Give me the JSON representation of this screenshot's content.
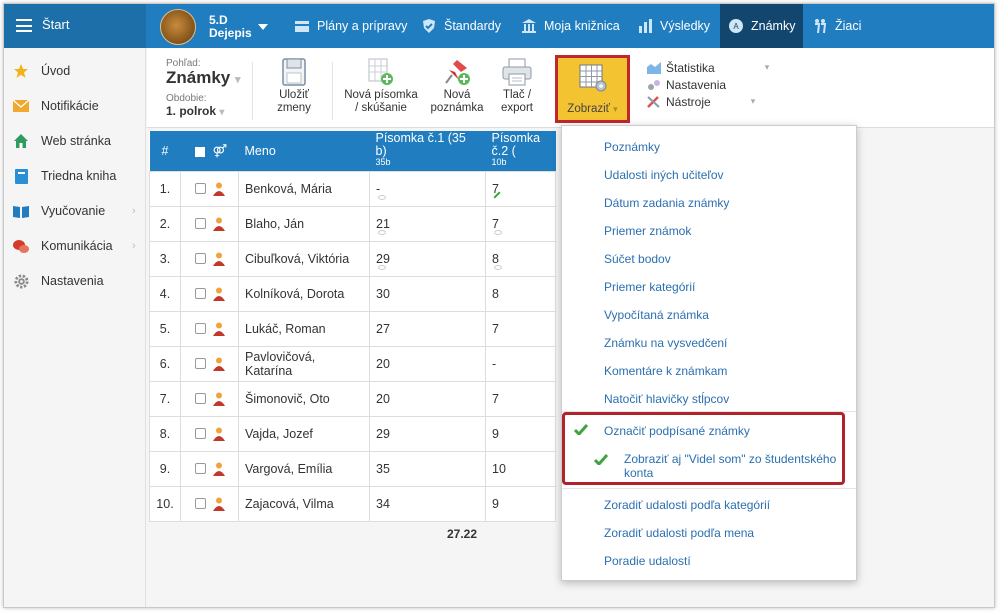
{
  "topbar": {
    "start": "Štart",
    "class_code": "5.D",
    "class_subject": "Dejepis",
    "nav": [
      {
        "label": "Plány a prípravy",
        "icon": "folder-icon"
      },
      {
        "label": "Štandardy",
        "icon": "shield-icon"
      },
      {
        "label": "Moja knižnica",
        "icon": "library-icon"
      },
      {
        "label": "Výsledky",
        "icon": "bar-chart-icon"
      },
      {
        "label": "Známky",
        "icon": "grade-icon"
      },
      {
        "label": "Žiaci",
        "icon": "students-icon"
      }
    ]
  },
  "sidebar": {
    "items": [
      {
        "label": "Úvod",
        "icon": "star-icon"
      },
      {
        "label": "Notifikácie",
        "icon": "envelope-icon"
      },
      {
        "label": "Web stránka",
        "icon": "home-icon"
      },
      {
        "label": "Triedna kniha",
        "icon": "book-icon"
      },
      {
        "label": "Vyučovanie",
        "icon": "open-book-icon"
      },
      {
        "label": "Komunikácia",
        "icon": "chat-icon"
      },
      {
        "label": "Nastavenia",
        "icon": "gear-icon"
      }
    ]
  },
  "toolbar": {
    "view_label": "Pohľad:",
    "view_value": "Známky",
    "period_label": "Obdobie:",
    "period_value": "1. polrok",
    "save_line1": "Uložiť",
    "save_line2": "zmeny",
    "new_test_line1": "Nová písomka",
    "new_test_line2": "/ skúšanie",
    "new_note_line1": "Nová",
    "new_note_line2": "poznámka",
    "print_line1": "Tlač /",
    "print_line2": "export",
    "show": "Zobraziť",
    "statistics": "Štatistika",
    "settings": "Nastavenia",
    "tools": "Nástroje"
  },
  "grid": {
    "headers": {
      "num": "#",
      "name": "Meno",
      "col1": "Písomka č.1 (35 b)",
      "col1_sub": "35b",
      "col2": "Písomka č.2 (",
      "col2_sub": "10b"
    },
    "rows": [
      {
        "n": "1.",
        "name": "Benková, Mária",
        "g1": "-",
        "g2": "7"
      },
      {
        "n": "2.",
        "name": "Blaho, Ján",
        "g1": "21",
        "g2": "7"
      },
      {
        "n": "3.",
        "name": "Cibuľková, Viktória",
        "g1": "29",
        "g2": "8"
      },
      {
        "n": "4.",
        "name": "Kolníková, Dorota",
        "g1": "30",
        "g2": "8"
      },
      {
        "n": "5.",
        "name": "Lukáč, Roman",
        "g1": "27",
        "g2": "7"
      },
      {
        "n": "6.",
        "name": "Pavlovičová, Katarína",
        "g1": "20",
        "g2": "-"
      },
      {
        "n": "7.",
        "name": "Šimonovič, Oto",
        "g1": "20",
        "g2": "7"
      },
      {
        "n": "8.",
        "name": "Vajda, Jozef",
        "g1": "29",
        "g2": "9"
      },
      {
        "n": "9.",
        "name": "Vargová, Emília",
        "g1": "35",
        "g2": "10"
      },
      {
        "n": "10.",
        "name": "Zajacová, Vilma",
        "g1": "34",
        "g2": "9"
      }
    ],
    "average": "27.22"
  },
  "dropdown": {
    "items": [
      "Poznámky",
      "Udalosti iných učiteľov",
      "Dátum zadania známky",
      "Priemer známok",
      "Súčet bodov",
      "Priemer kategórií",
      "Vypočítaná známka",
      "Známku na vysvedčení",
      "Komentáre k známkam",
      "Natočiť hlavičky stĺpcov"
    ],
    "checked1": "Označiť podpísané známky",
    "checked2_line1": "Zobraziť aj \"Videl som\" zo študentského",
    "checked2_line2": "konta",
    "sort": [
      "Zoradiť udalosti podľa kategórií",
      "Zoradiť udalosti podľa mena",
      "Poradie udalostí"
    ]
  },
  "colors": {
    "accent": "#1f7dc0",
    "highlight": "#f4c331",
    "link": "#2b6fb0",
    "outline": "#c0272d"
  }
}
